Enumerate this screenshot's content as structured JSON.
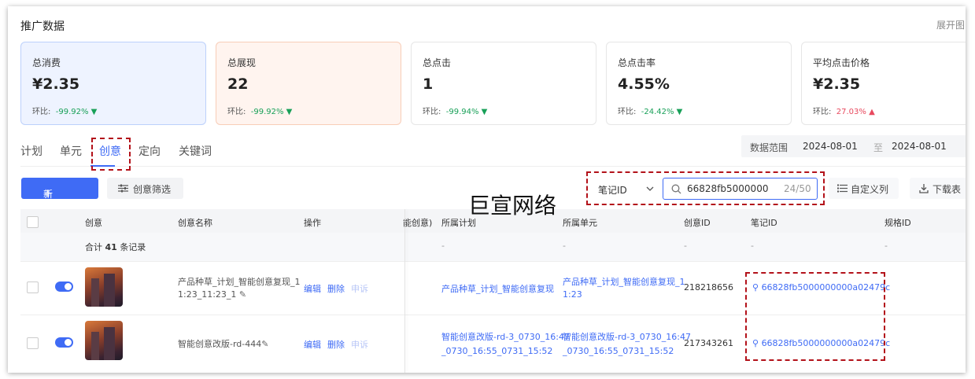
{
  "section": {
    "title": "推广数据",
    "expand": "展开图"
  },
  "cards": [
    {
      "label": "总消费",
      "value": "¥2.35",
      "cmp_label": "环比:",
      "cmp_value": "-99.92%",
      "trend": "down",
      "arrow": "▼"
    },
    {
      "label": "总展现",
      "value": "22",
      "cmp_label": "环比:",
      "cmp_value": "-99.92%",
      "trend": "down",
      "arrow": "▼"
    },
    {
      "label": "总点击",
      "value": "1",
      "cmp_label": "环比:",
      "cmp_value": "-99.94%",
      "trend": "down",
      "arrow": "▼"
    },
    {
      "label": "总点击率",
      "value": "4.55%",
      "cmp_label": "环比:",
      "cmp_value": "-24.42%",
      "trend": "down",
      "arrow": "▼"
    },
    {
      "label": "平均点击价格",
      "value": "¥2.35",
      "cmp_label": "环比:",
      "cmp_value": "27.03%",
      "trend": "up",
      "arrow": "▲"
    }
  ],
  "tabs": [
    "计划",
    "单元",
    "创意",
    "定向",
    "关键词"
  ],
  "active_tab": "创意",
  "date_range": {
    "label": "数据范围",
    "start": "2024-08-01",
    "sep": "至",
    "end": "2024-08-01"
  },
  "toolbar": {
    "new_button": "新建创意",
    "new_icon": "+",
    "filter_button": "创意筛选",
    "search_field_select": "笔记ID",
    "search_value": "66828fb5000000",
    "search_count": "24/50",
    "custom_columns": "自定义列",
    "download": "下载表"
  },
  "watermark": "巨宣网络",
  "table": {
    "headers": {
      "creative": "创意",
      "name": "创意名称",
      "ops": "操作",
      "partial": "能创意)",
      "plan": "所属计划",
      "unit": "所属单元",
      "creative_id": "创意ID",
      "note_id": "笔记ID",
      "spec_id": "规格ID"
    },
    "summary": {
      "prefix": "合计",
      "count": "41",
      "suffix": "条记录",
      "dash": "-"
    },
    "ops": {
      "edit": "编辑",
      "delete": "删除",
      "appeal": "申诉"
    },
    "rows": [
      {
        "name_line1": "产品种草_计划_智能创意复现_1",
        "name_line2": "1:23_11:23_1",
        "plan_line1": "产品种草_计划_智能创意复现",
        "plan_line2": "",
        "unit_line1": "产品种草_计划_智能创意复现_1",
        "unit_line2": "1:23",
        "creative_id": "218218656",
        "note_id": "66828fb5000000000a02479c",
        "spec": "-"
      },
      {
        "name_line1": "智能创意改版-rd-444",
        "name_line2": "",
        "plan_line1": "智能创意改版-rd-3_0730_16:47",
        "plan_line2": "_0730_16:55_0731_15:52",
        "unit_line1": "智能创意改版-rd-3_0730_16:47",
        "unit_line2": "_0730_16:55_0731_15:52",
        "creative_id": "217343261",
        "note_id": "66828fb5000000000a02479c",
        "spec": "-"
      }
    ]
  },
  "colors": {
    "accent": "#3f6bf5",
    "down": "#18a058",
    "up": "#e84a5f",
    "highlight": "#b3121a"
  }
}
